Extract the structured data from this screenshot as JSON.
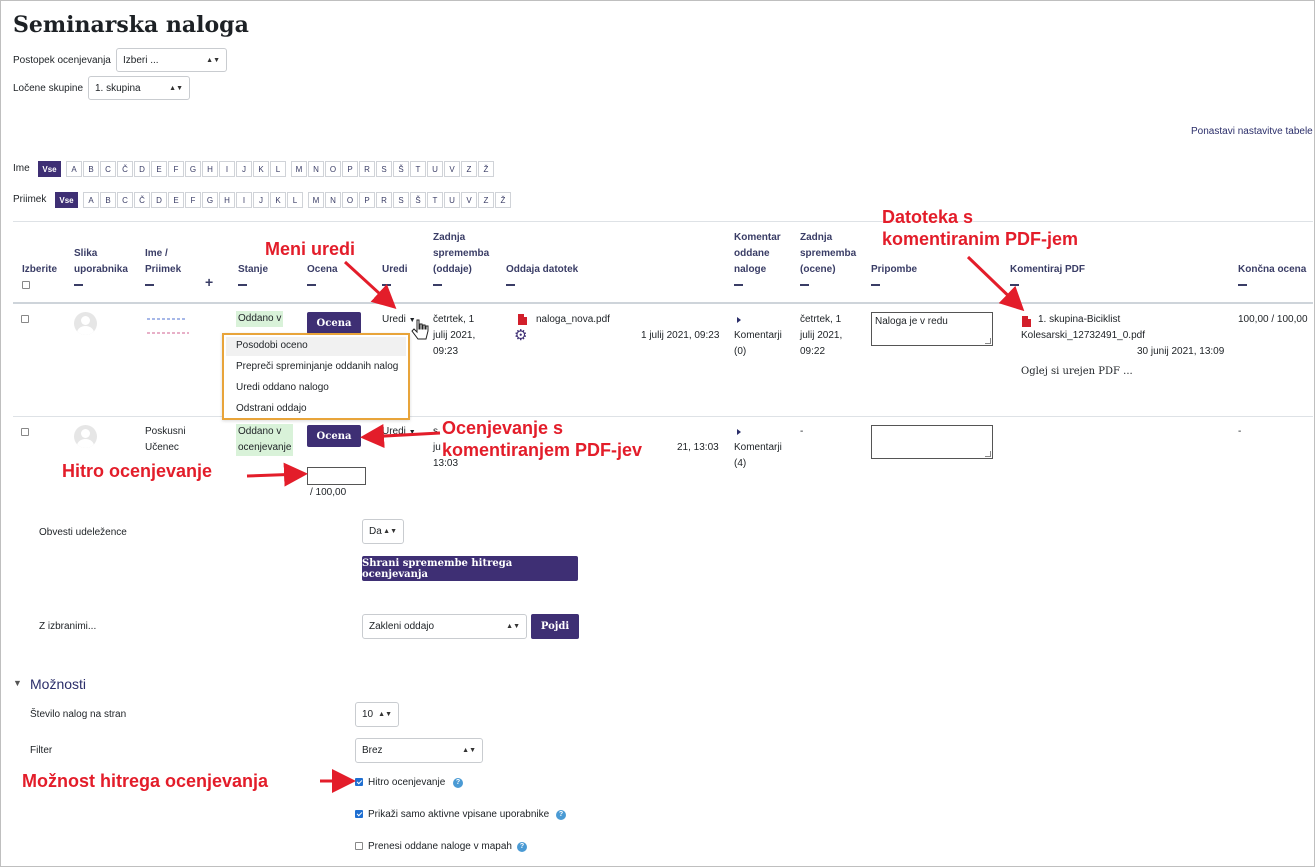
{
  "page": {
    "title": "Seminarska naloga",
    "reset_link": "Ponastavi nastavitve tabele"
  },
  "filters": {
    "grading_label": "Postopek ocenjevanja",
    "grading_value": "Izberi ...",
    "groups_label": "Ločene skupine",
    "groups_value": "1. skupina"
  },
  "alphabet": {
    "first_label": "Ime",
    "last_label": "Priimek",
    "all": "Vse",
    "letters": [
      "A",
      "B",
      "C",
      "Č",
      "D",
      "E",
      "F",
      "G",
      "H",
      "I",
      "J",
      "K",
      "L",
      "M",
      "N",
      "O",
      "P",
      "R",
      "S",
      "Š",
      "T",
      "U",
      "V",
      "Z",
      "Ž"
    ]
  },
  "columns": {
    "select": "Izberite",
    "picture": [
      "Slika",
      "uporabnika"
    ],
    "name": [
      "Ime /",
      "Priimek"
    ],
    "status": "Stanje",
    "grade": "Ocena",
    "edit": "Uredi",
    "last_modified": [
      "Zadnja",
      "sprememba",
      "(oddaje)"
    ],
    "files": "Oddaja datotek",
    "comments": [
      "Komentar",
      "oddane",
      "naloge"
    ],
    "last_grade": [
      "Zadnja",
      "sprememba",
      "(ocene)"
    ],
    "feedback": "Pripombe",
    "annotate": "Komentiraj PDF",
    "final": "Končna ocena"
  },
  "rows": [
    {
      "status": [
        "Oddano v"
      ],
      "grade_btn": "Ocena",
      "edit": "Uredi",
      "modified": [
        "četrtek, 1",
        "julij 2021,",
        "09:23"
      ],
      "file": "naloga_nova.pdf",
      "file_date": "1 julij 2021, 09:23",
      "comments": [
        "Komentarji",
        "(0)"
      ],
      "grade_modified": [
        "četrtek, 1",
        "julij 2021,",
        "09:22"
      ],
      "feedback": "Naloga je v redu",
      "annotated_pdf": [
        "1. skupina-Biciklist",
        "Kolesarski_12732491_0.pdf"
      ],
      "annotated_date": "30 junij 2021, 13:09",
      "view_pdf": "Oglej si urejen PDF ...",
      "final": "100,00 / 100,00"
    },
    {
      "name": [
        "Poskusni",
        "Učenec"
      ],
      "status": [
        "Oddano v",
        "ocenjevanje"
      ],
      "grade_btn": "Ocena",
      "edit": "Uredi",
      "grade_suffix": "/ 100,00",
      "modified": [
        "s",
        "ju",
        "13:03"
      ],
      "file_date": "21, 13:03",
      "comments": [
        "Komentarji",
        "(4)"
      ],
      "grade_modified": "-",
      "final": "-"
    }
  ],
  "edit_menu": [
    "Posodobi oceno",
    "Prepreči spreminjanje oddanih nalog",
    "Uredi oddano nalogo",
    "Odstrani oddajo"
  ],
  "quick": {
    "notify_label": "Obvesti udeležence",
    "notify_value": "Da",
    "save_btn": "Shrani spremembe hitrega ocenjevanja",
    "with_selected": "Z izbranimi...",
    "action_value": "Zakleni oddajo",
    "go_btn": "Pojdi"
  },
  "options": {
    "title": "Možnosti",
    "per_page_label": "Število nalog na stran",
    "per_page_value": "10",
    "filter_label": "Filter",
    "filter_value": "Brez",
    "quick_grading": "Hitro ocenjevanje",
    "only_active": "Prikaži samo aktivne vpisane uporabnike",
    "download_folders": "Prenesi oddane naloge v mapah"
  },
  "annotations": {
    "edit_menu": "Meni uredi",
    "annotated_pdf": [
      "Datoteka s",
      "komentiranim PDF-jem"
    ],
    "pdf_grading": [
      "Ocenjevanje s",
      "komentiranjem PDF-jev"
    ],
    "quick_grading": "Hitro ocenjevanje",
    "quick_option": "Možnost hitrega ocenjevanja"
  },
  "colors": {
    "primary": "#3e2f74",
    "link": "#2b2e6a",
    "annotation": "#e31d2a",
    "highlight_border": "#e8a43a",
    "status_bg": "#d9f2d9"
  }
}
